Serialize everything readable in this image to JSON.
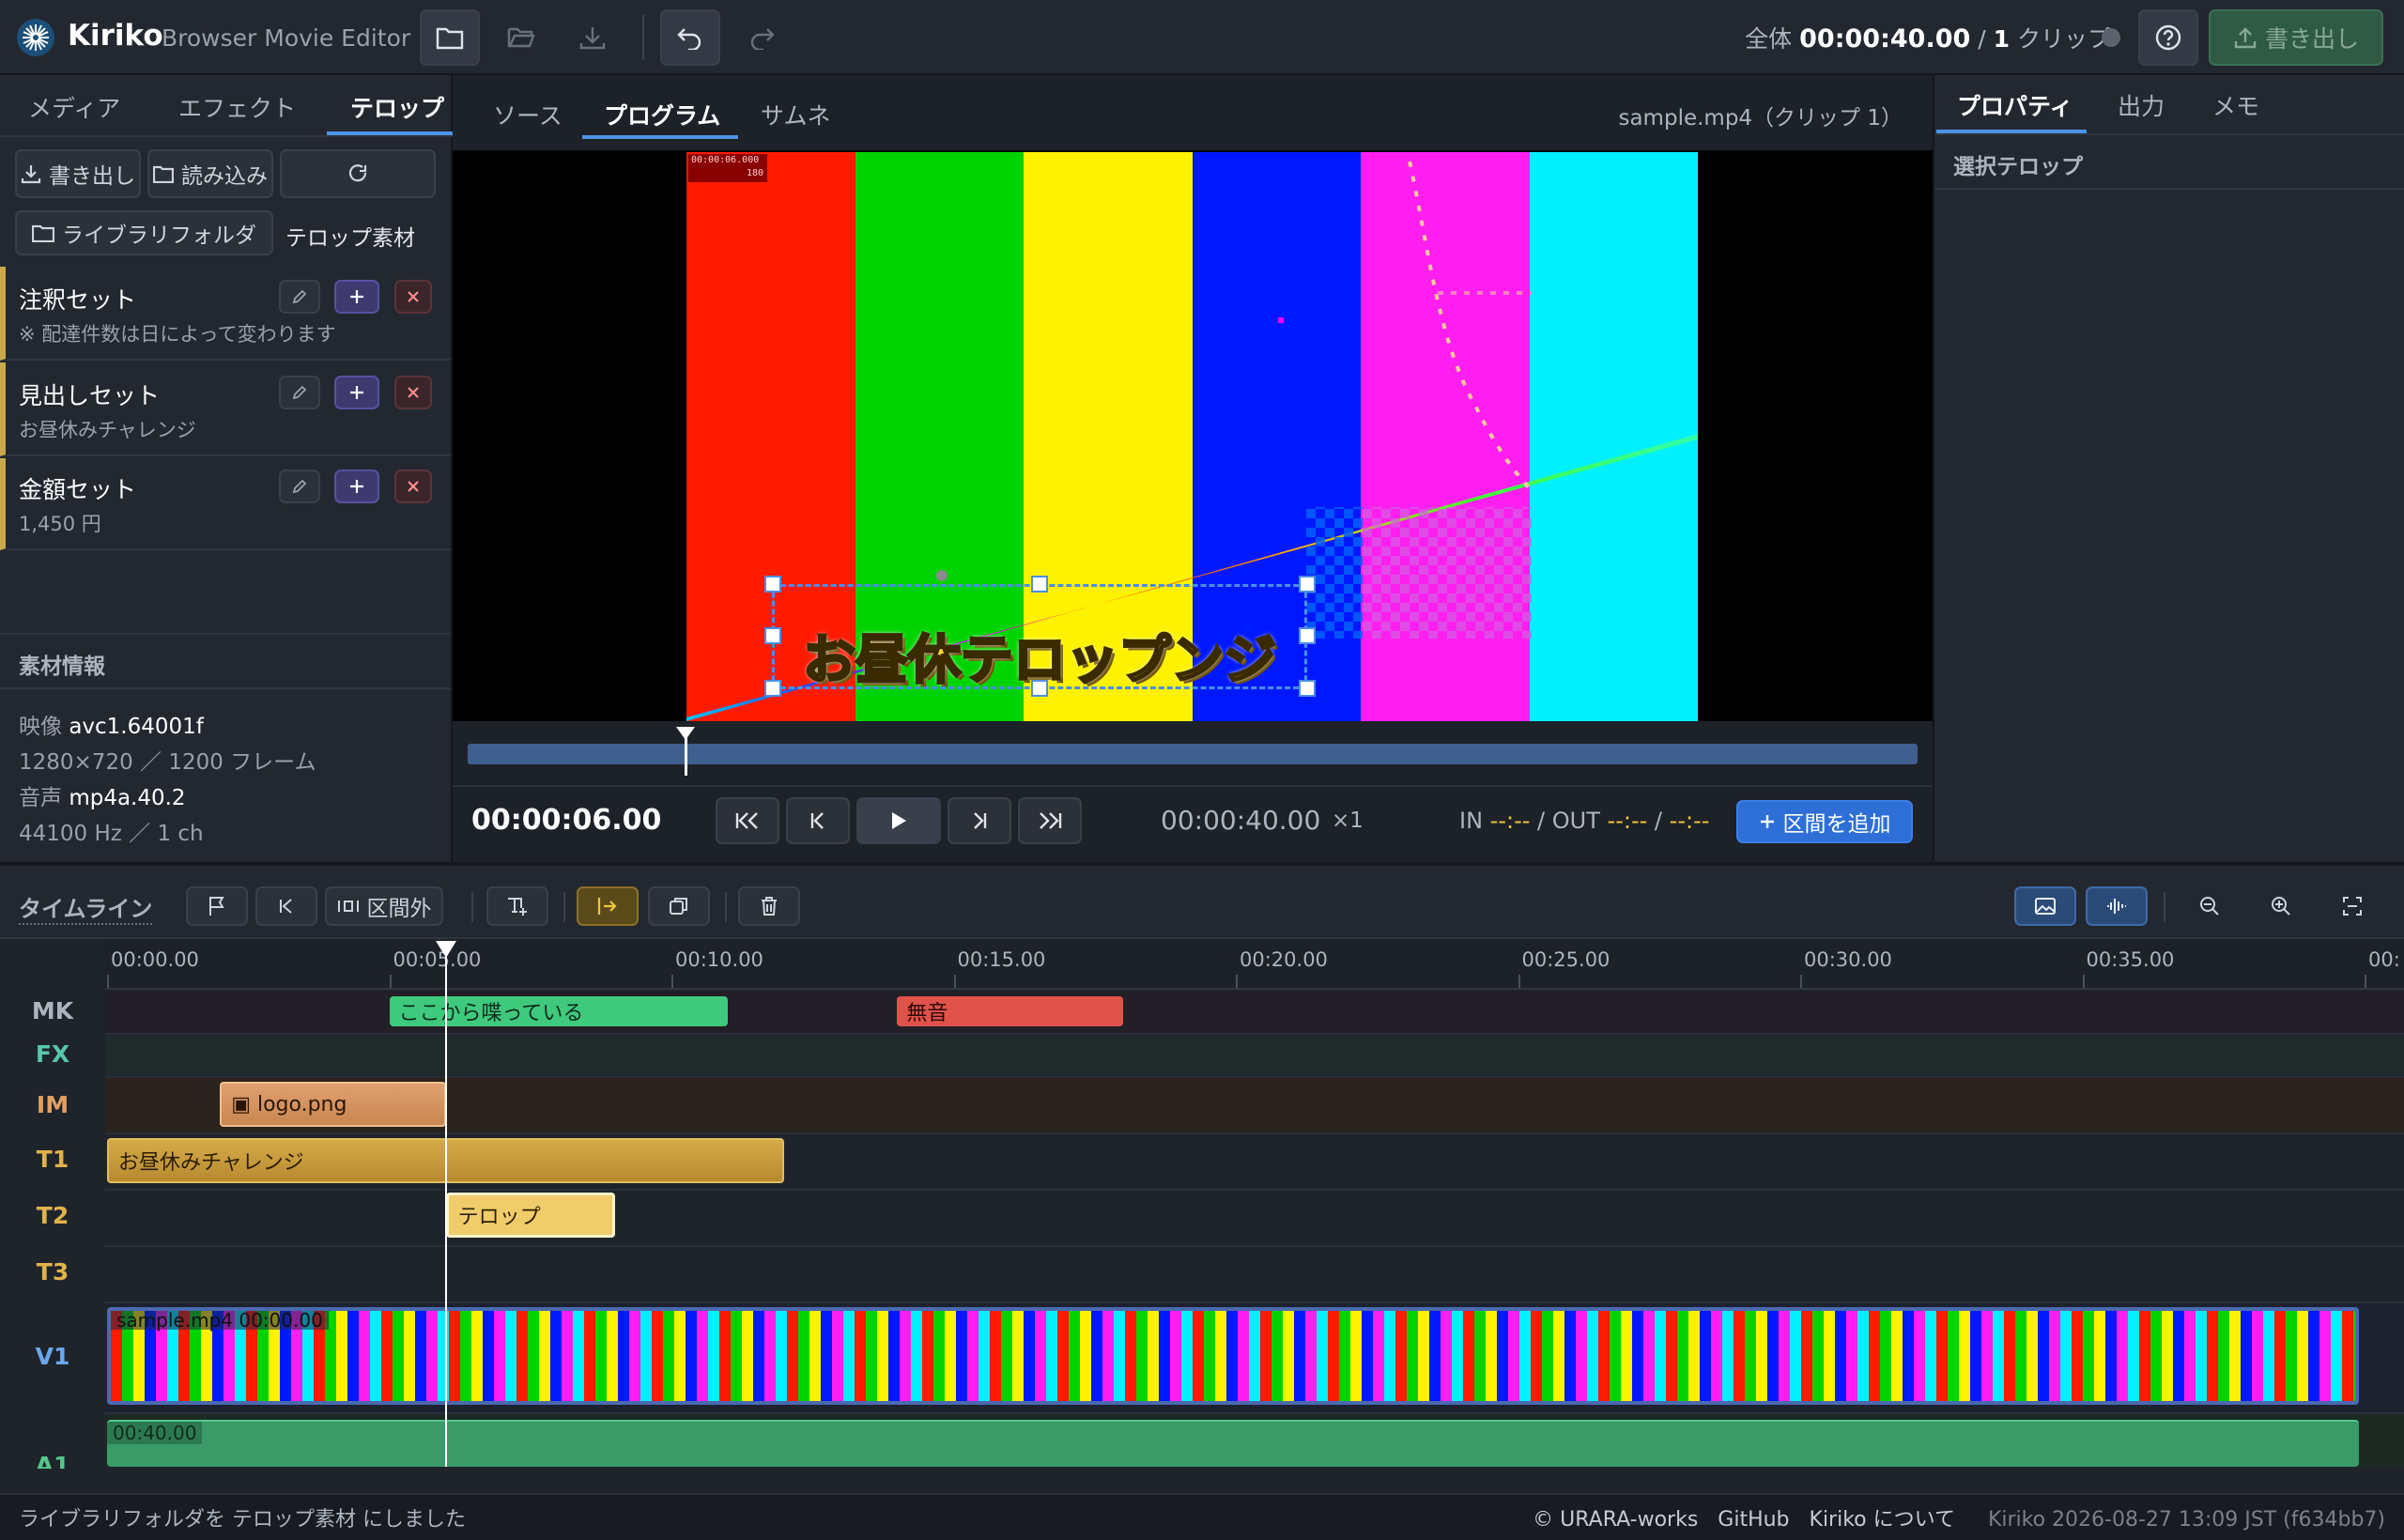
{
  "app": {
    "name": "Kiriko",
    "subtitle": "Browser Movie Editor"
  },
  "header": {
    "total_label": "全体",
    "total_time": "00:00:40.00",
    "sep": "/",
    "clip_count": "1",
    "clip_unit": "クリップ",
    "export_label": "書き出し"
  },
  "left": {
    "tabs": [
      "メディア",
      "エフェクト",
      "テロップ"
    ],
    "export_label": "書き出し",
    "import_label": "読み込み",
    "library_btn": "ライブラリフォルダ",
    "library_name": "テロップ素材",
    "sets": [
      {
        "name": "注釈セット",
        "desc": "※ 配達件数は日によって変わります"
      },
      {
        "name": "見出しセット",
        "desc": "お昼休みチャレンジ"
      },
      {
        "name": "金額セット",
        "desc": "1,450 円"
      }
    ],
    "info_title": "素材情報",
    "video_label": "映像",
    "video_codec": "avc1.64001f",
    "video_meta": "1280×720 ／ 1200 フレーム",
    "audio_label": "音声",
    "audio_codec": "mp4a.40.2",
    "audio_meta": "44100 Hz ／ 1 ch"
  },
  "center": {
    "tabs": [
      "ソース",
      "プログラム",
      "サムネ"
    ],
    "file_label": "sample.mp4（クリップ 1）",
    "overlay_time": "00:00:06.000",
    "overlay_frame": "180",
    "caption": "お昼休テロップンジ",
    "current_time": "00:00:06.00",
    "duration": "00:00:40.00",
    "speed": "×1",
    "in_label": "IN",
    "in_value": "--:--",
    "out_label": "OUT",
    "out_value": "--:--",
    "slash": "/",
    "end_value": "--:--",
    "add_range": "区間を追加",
    "playhead_fraction": 0.15,
    "bars": [
      "#ff1a00",
      "#00d400",
      "#fff200",
      "#0018ff",
      "#ff1ef0",
      "#00f0ff"
    ]
  },
  "right": {
    "tabs": [
      "プロパティ",
      "出力",
      "メモ"
    ],
    "section_title": "選択テロップ"
  },
  "timeline": {
    "title": "タイムライン",
    "outside_label": "区間外",
    "ticks": [
      "00:00.00",
      "00:05.00",
      "00:10.00",
      "00:15.00",
      "00:20.00",
      "00:25.00",
      "00:30.00",
      "00:35.00",
      "00:"
    ],
    "tracks": [
      "MK",
      "FX",
      "IM",
      "T1",
      "T2",
      "T3",
      "V1",
      "A1"
    ],
    "markers": [
      {
        "label": "ここから喋っている",
        "start": 5,
        "end": 11,
        "color": "#3ec97d"
      },
      {
        "label": "無音",
        "start": 14,
        "end": 18,
        "color": "#e0524a"
      }
    ],
    "image_clip": {
      "label": "▣ logo.png",
      "start": 2,
      "end": 6
    },
    "t1_clip": {
      "label": "お昼休みチャレンジ",
      "start": 0,
      "end": 12
    },
    "t2_clip": {
      "label": "テロップ",
      "start": 6,
      "end": 9
    },
    "video_clip": {
      "label": "sample.mp4",
      "time": "00:00.00",
      "start": 0,
      "end": 40
    },
    "audio_clip": {
      "label": "00:40.00",
      "start": 0,
      "end": 40
    },
    "playhead_seconds": 6
  },
  "status": {
    "message": "ライブラリフォルダを テロップ素材 にしました",
    "credit": "© URARA-works",
    "github": "GitHub",
    "about": "Kiriko について",
    "version": "Kiriko 2026-08-27 13:09 JST (f634bb7)"
  }
}
